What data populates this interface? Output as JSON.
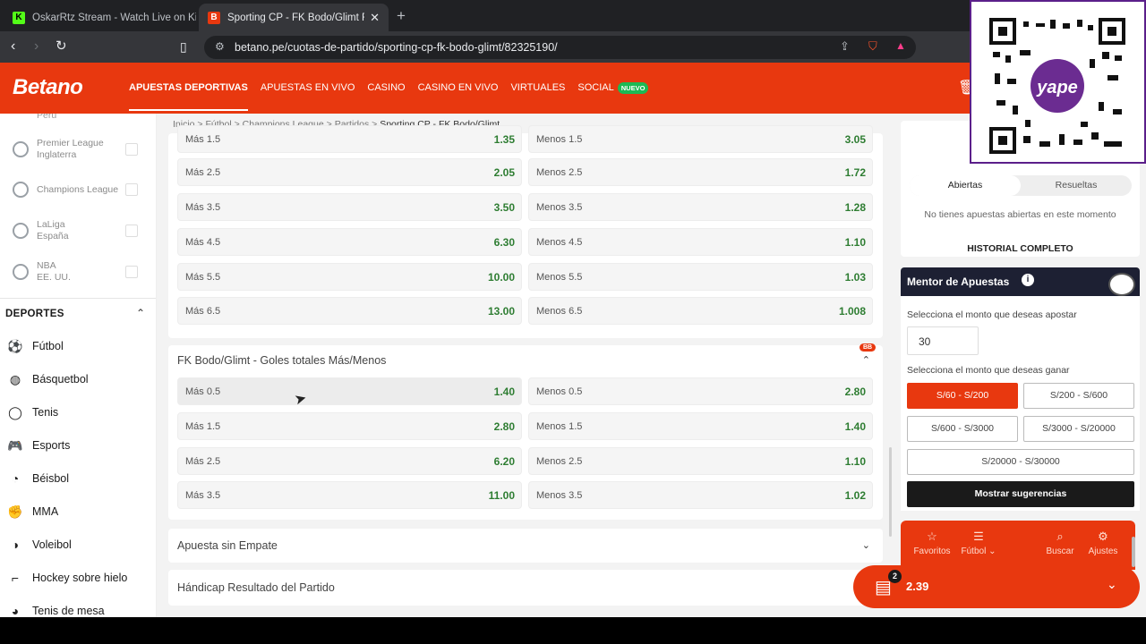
{
  "browser": {
    "tabs": [
      {
        "title": "OskarRtz Stream - Watch Live on Kick",
        "favicon_color": "#53fc18",
        "favicon_letter": "K"
      },
      {
        "title": "Sporting CP - FK Bodo/Glimt Fút",
        "favicon_color": "#e8380f",
        "favicon_letter": "B",
        "active": true
      }
    ],
    "url": "betano.pe/cuotas-de-partido/sporting-cp-fk-bodo-glimt/82325190/"
  },
  "site": {
    "logo": "Betano",
    "nav": [
      "APUESTAS DEPORTIVAS",
      "APUESTAS EN VIVO",
      "CASINO",
      "CASINO EN VIVO",
      "VIRTUALES",
      "SOCIAL"
    ],
    "nav_badge": "NUEVO",
    "brand_color": "#e8380f"
  },
  "sidebar": {
    "partial_top": "Perú",
    "leagues": [
      {
        "name": "Premier League",
        "sub": "Inglaterra"
      },
      {
        "name": "Champions League",
        "sub": ""
      },
      {
        "name": "LaLiga",
        "sub": "España"
      },
      {
        "name": "NBA",
        "sub": "EE. UU."
      }
    ],
    "section_title": "DEPORTES",
    "sports": [
      {
        "label": "Fútbol",
        "icon": "soccer-ball-icon"
      },
      {
        "label": "Básquetbol",
        "icon": "basketball-icon"
      },
      {
        "label": "Tenis",
        "icon": "tennis-icon"
      },
      {
        "label": "Esports",
        "icon": "gamepad-icon"
      },
      {
        "label": "Béisbol",
        "icon": "baseball-icon"
      },
      {
        "label": "MMA",
        "icon": "glove-icon"
      },
      {
        "label": "Voleibol",
        "icon": "volleyball-icon"
      },
      {
        "label": "Hockey sobre hielo",
        "icon": "hockey-icon"
      },
      {
        "label": "Tenis de mesa",
        "icon": "table-tennis-icon"
      }
    ]
  },
  "breadcrumb": [
    "Inicio",
    "Fútbol",
    "Champions League",
    "Partidos",
    "Sporting CP - FK Bodo/Glimt"
  ],
  "market1": {
    "rows": [
      {
        "over": "Más 1.5",
        "over_odd": "1.35",
        "under": "Menos 1.5",
        "under_odd": "3.05"
      },
      {
        "over": "Más 2.5",
        "over_odd": "2.05",
        "under": "Menos 2.5",
        "under_odd": "1.72"
      },
      {
        "over": "Más 3.5",
        "over_odd": "3.50",
        "under": "Menos 3.5",
        "under_odd": "1.28"
      },
      {
        "over": "Más 4.5",
        "over_odd": "6.30",
        "under": "Menos 4.5",
        "under_odd": "1.10"
      },
      {
        "over": "Más 5.5",
        "over_odd": "10.00",
        "under": "Menos 5.5",
        "under_odd": "1.03"
      },
      {
        "over": "Más 6.5",
        "over_odd": "13.00",
        "under": "Menos 6.5",
        "under_odd": "1.008"
      }
    ]
  },
  "market2": {
    "title": "FK Bodo/Glimt - Goles totales Más/Menos",
    "badge": "BB",
    "rows": [
      {
        "over": "Más 0.5",
        "over_odd": "1.40",
        "under": "Menos 0.5",
        "under_odd": "2.80"
      },
      {
        "over": "Más 1.5",
        "over_odd": "2.80",
        "under": "Menos 1.5",
        "under_odd": "1.40"
      },
      {
        "over": "Más 2.5",
        "over_odd": "6.20",
        "under": "Menos 2.5",
        "under_odd": "1.10"
      },
      {
        "over": "Más 3.5",
        "over_odd": "11.00",
        "under": "Menos 3.5",
        "under_odd": "1.02"
      }
    ]
  },
  "collapsed_markets": [
    "Apuesta sin Empate",
    "Hándicap Resultado del Partido"
  ],
  "rightpanel": {
    "tabs": [
      "Abiertas",
      "Resueltas"
    ],
    "empty_text": "No tienes apuestas abiertas en este momento",
    "history": "HISTORIAL COMPLETO",
    "mentor_title": "Mentor de Apuestas",
    "stake_label": "Selecciona el monto que deseas apostar",
    "stake_value": "30",
    "win_label": "Selecciona el monto que deseas ganar",
    "ranges": [
      "S/60 - S/200",
      "S/200 - S/600",
      "S/600 - S/3000",
      "S/3000 - S/20000",
      "S/20000 - S/30000"
    ],
    "suggest_btn": "Mostrar sugerencias",
    "bottom_items": [
      "Favoritos",
      "Fútbol",
      "Buscar",
      "Ajustes"
    ],
    "betslip_count": "2",
    "betslip_odds": "2.39"
  }
}
